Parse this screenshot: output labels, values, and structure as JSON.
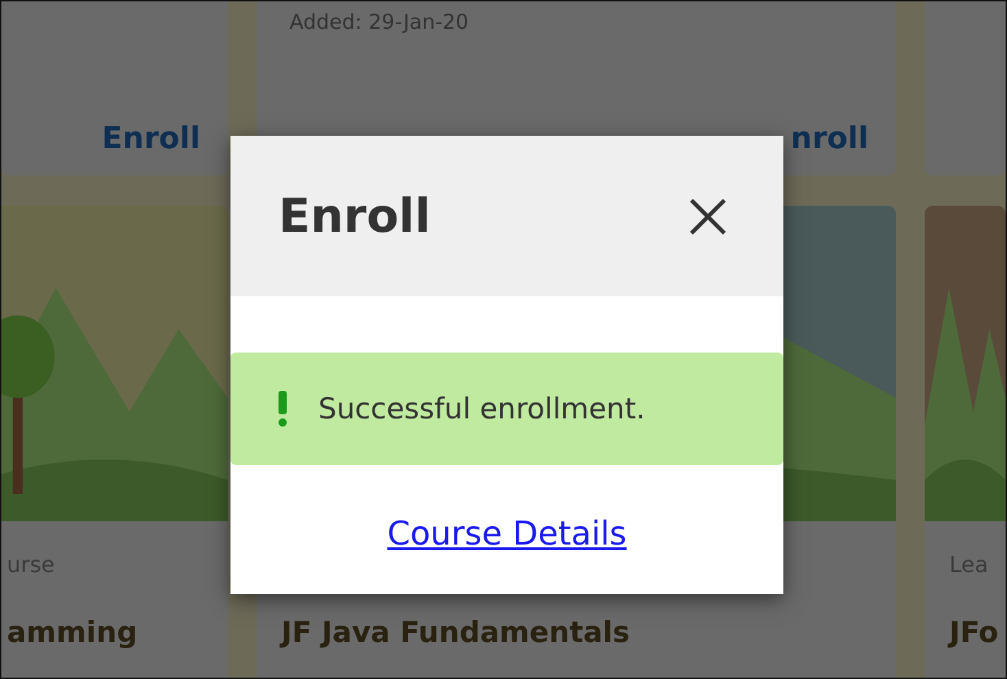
{
  "background_cards": {
    "top_row": [
      {
        "enroll_link": "Enroll"
      },
      {
        "added": "Added: 29-Jan-20",
        "enroll_link": "nroll"
      }
    ],
    "bottom_row": [
      {
        "category": "urse",
        "title": "amming"
      },
      {
        "title": "JF Java Fundamentals"
      },
      {
        "category": "Lea",
        "title": "JFo"
      }
    ]
  },
  "modal": {
    "title": "Enroll",
    "alert": {
      "kind": "success",
      "message": "Successful enrollment."
    },
    "link": "Course Details"
  }
}
